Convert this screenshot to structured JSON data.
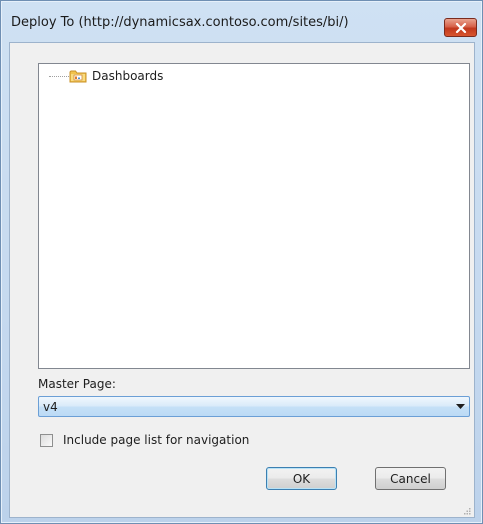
{
  "window": {
    "title": "Deploy To (http://dynamicsax.contoso.com/sites/bi/)"
  },
  "tree": {
    "items": [
      {
        "label": "Dashboards",
        "icon": "folder-icon"
      }
    ]
  },
  "master_page": {
    "label": "Master Page:",
    "value": "v4"
  },
  "include_nav": {
    "label": "Include page list for navigation",
    "checked": false
  },
  "buttons": {
    "ok_label": "OK",
    "cancel_label": "Cancel"
  },
  "colors": {
    "titlebar": "#c5d9ef",
    "close_button": "#c1381d",
    "combo_highlight": "#c5e0f7",
    "default_button_border": "#3c7fb1"
  }
}
